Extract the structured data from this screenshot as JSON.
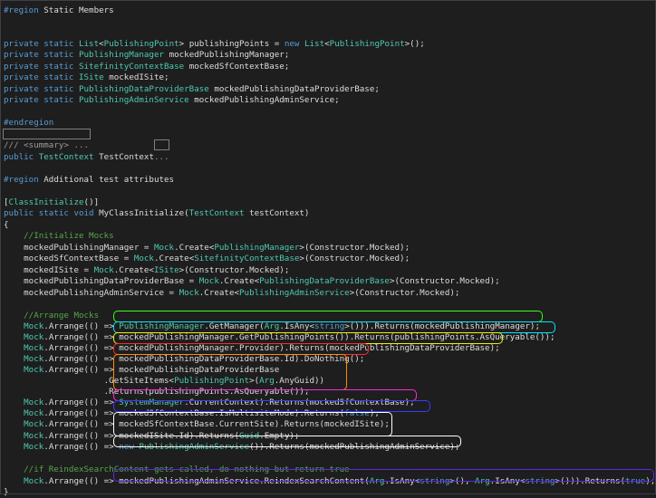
{
  "colors": {
    "background": "#1e1e1e",
    "keyword": "#569cd6",
    "type": "#4ec9b0",
    "comment": "#57a64a",
    "plain": "#dcdcdc",
    "collapsed": "#9b9b9b"
  },
  "lines": [
    [
      [
        "kw",
        "#region"
      ],
      [
        "pl",
        " Static Members"
      ]
    ],
    [],
    [
      [
        "kw",
        "private static "
      ],
      [
        "ty",
        "List"
      ],
      [
        "pl",
        "<"
      ],
      [
        "ty",
        "PublishingPoint"
      ],
      [
        "pl",
        "> publishingPoints = "
      ],
      [
        "kw",
        "new "
      ],
      [
        "ty",
        "List"
      ],
      [
        "pl",
        "<"
      ],
      [
        "ty",
        "PublishingPoint"
      ],
      [
        "pl",
        ">();"
      ]
    ],
    [
      [
        "kw",
        "private static "
      ],
      [
        "ty",
        "PublishingManager"
      ],
      [
        "pl",
        " mockedPublishingManager;"
      ]
    ],
    [
      [
        "kw",
        "private static "
      ],
      [
        "ty",
        "SitefinityContextBase"
      ],
      [
        "pl",
        " mockedSfContextBase;"
      ]
    ],
    [
      [
        "kw",
        "private static "
      ],
      [
        "ty",
        "ISite"
      ],
      [
        "pl",
        " mockedISite;"
      ]
    ],
    [
      [
        "kw",
        "private static "
      ],
      [
        "ty",
        "PublishingDataProviderBase"
      ],
      [
        "pl",
        " mockedPublishingDataProviderBase;"
      ]
    ],
    [
      [
        "kw",
        "private static "
      ],
      [
        "ty",
        "PublishingAdminService"
      ],
      [
        "pl",
        " mockedPublishingAdminService;"
      ]
    ],
    [],
    [
      [
        "kw",
        "#endregion"
      ]
    ],
    [],
    [
      [
        "gr",
        "/// <summary> ..."
      ]
    ],
    [
      [
        "kw",
        "public "
      ],
      [
        "ty",
        "TestContext"
      ],
      [
        "pl",
        " TestContext"
      ],
      [
        "gr",
        "..."
      ]
    ],
    [],
    [
      [
        "kw",
        "#region"
      ],
      [
        "pl",
        " Additional test attributes"
      ]
    ],
    [],
    [
      [
        "pl",
        "["
      ],
      [
        "ty",
        "ClassInitialize"
      ],
      [
        "pl",
        "()]"
      ]
    ],
    [
      [
        "kw",
        "public static void "
      ],
      [
        "pl",
        "MyClassInitialize("
      ],
      [
        "ty",
        "TestContext"
      ],
      [
        "pl",
        " testContext)"
      ]
    ],
    [
      [
        "pl",
        "{"
      ]
    ],
    [
      [
        "cm",
        "    //Initialize Mocks"
      ]
    ],
    [
      [
        "pl",
        "    mockedPublishingManager = "
      ],
      [
        "ty",
        "Mock"
      ],
      [
        "pl",
        ".Create<"
      ],
      [
        "ty",
        "PublishingManager"
      ],
      [
        "pl",
        ">(Constructor.Mocked);"
      ]
    ],
    [
      [
        "pl",
        "    mockedSfContextBase = "
      ],
      [
        "ty",
        "Mock"
      ],
      [
        "pl",
        ".Create<"
      ],
      [
        "ty",
        "SitefinityContextBase"
      ],
      [
        "pl",
        ">(Constructor.Mocked);"
      ]
    ],
    [
      [
        "pl",
        "    mockedISite = "
      ],
      [
        "ty",
        "Mock"
      ],
      [
        "pl",
        ".Create<"
      ],
      [
        "ty",
        "ISite"
      ],
      [
        "pl",
        ">(Constructor.Mocked);"
      ]
    ],
    [
      [
        "pl",
        "    mockedPublishingDataProviderBase = "
      ],
      [
        "ty",
        "Mock"
      ],
      [
        "pl",
        ".Create<"
      ],
      [
        "ty",
        "PublishingDataProviderBase"
      ],
      [
        "pl",
        ">(Constructor.Mocked);"
      ]
    ],
    [
      [
        "pl",
        "    mockedPublishingAdminService = "
      ],
      [
        "ty",
        "Mock"
      ],
      [
        "pl",
        ".Create<"
      ],
      [
        "ty",
        "PublishingAdminService"
      ],
      [
        "pl",
        ">(Constructor.Mocked);"
      ]
    ],
    [],
    [
      [
        "cm",
        "    //Arrange Mocks"
      ]
    ],
    [
      [
        "pl",
        "    "
      ],
      [
        "ty",
        "Mock"
      ],
      [
        "pl",
        ".Arrange(() => "
      ],
      [
        "ty",
        "PublishingManager"
      ],
      [
        "pl",
        ".GetManager("
      ],
      [
        "ty",
        "Arg"
      ],
      [
        "pl",
        ".IsAny<"
      ],
      [
        "kw",
        "string"
      ],
      [
        "pl",
        ">())).Returns(mockedPublishingManager);"
      ]
    ],
    [
      [
        "pl",
        "    "
      ],
      [
        "ty",
        "Mock"
      ],
      [
        "pl",
        ".Arrange(() => mockedPublishingManager.GetPublishingPoints()).Returns(publishingPoints.AsQueryable());"
      ]
    ],
    [
      [
        "pl",
        "    "
      ],
      [
        "ty",
        "Mock"
      ],
      [
        "pl",
        ".Arrange(() => mockedPublishingManager.Provider).Returns(mockedPublishingDataProviderBase);"
      ]
    ],
    [
      [
        "pl",
        "    "
      ],
      [
        "ty",
        "Mock"
      ],
      [
        "pl",
        ".Arrange(() => mockedPublishingDataProviderBase.Id).DoNothing();"
      ]
    ],
    [
      [
        "pl",
        "    "
      ],
      [
        "ty",
        "Mock"
      ],
      [
        "pl",
        ".Arrange(() => mockedPublishingDataProviderBase"
      ]
    ],
    [
      [
        "pl",
        "                    .GetSiteItems<"
      ],
      [
        "ty",
        "PublishingPoint"
      ],
      [
        "pl",
        ">("
      ],
      [
        "ty",
        "Arg"
      ],
      [
        "pl",
        ".AnyGuid))"
      ]
    ],
    [
      [
        "pl",
        "                    .Returns(publishingPoints.AsQueryable());"
      ]
    ],
    [
      [
        "pl",
        "    "
      ],
      [
        "ty",
        "Mock"
      ],
      [
        "pl",
        ".Arrange(() => "
      ],
      [
        "ty",
        "SystemManager"
      ],
      [
        "pl",
        ".CurrentContext).Returns(mockedSfContextBase);"
      ]
    ],
    [
      [
        "pl",
        "    "
      ],
      [
        "ty",
        "Mock"
      ],
      [
        "pl",
        ".Arrange(() => mockedSfContextBase.IsMultisiteMode).Returns("
      ],
      [
        "kw",
        "false"
      ],
      [
        "pl",
        ");"
      ]
    ],
    [
      [
        "pl",
        "    "
      ],
      [
        "ty",
        "Mock"
      ],
      [
        "pl",
        ".Arrange(() => mockedSfContextBase.CurrentSite).Returns(mockedISite);"
      ]
    ],
    [
      [
        "pl",
        "    "
      ],
      [
        "ty",
        "Mock"
      ],
      [
        "pl",
        ".Arrange(() => mockedISite.Id).Returns("
      ],
      [
        "ty",
        "Guid"
      ],
      [
        "pl",
        ".Empty);"
      ]
    ],
    [
      [
        "pl",
        "    "
      ],
      [
        "ty",
        "Mock"
      ],
      [
        "pl",
        ".Arrange(() => "
      ],
      [
        "kw",
        "new "
      ],
      [
        "ty",
        "PublishingAdminService"
      ],
      [
        "pl",
        "()).Returns(mockedPublishingAdminService);"
      ]
    ],
    [],
    [
      [
        "cm",
        "    //if ReindexSearchContent gets called, do nothing but return true"
      ]
    ],
    [
      [
        "pl",
        "    "
      ],
      [
        "ty",
        "Mock"
      ],
      [
        "pl",
        ".Arrange(() => mockedPublishingAdminService.ReindexSearchContent("
      ],
      [
        "ty",
        "Arg"
      ],
      [
        "pl",
        ".IsAny<"
      ],
      [
        "kw",
        "string"
      ],
      [
        "pl",
        ">(), "
      ],
      [
        "ty",
        "Arg"
      ],
      [
        "pl",
        ".IsAny<"
      ],
      [
        "kw",
        "string"
      ],
      [
        "pl",
        ">())).Returns("
      ],
      [
        "kw",
        "true"
      ],
      [
        "pl",
        ");"
      ]
    ],
    [
      [
        "pl",
        "}"
      ]
    ]
  ]
}
